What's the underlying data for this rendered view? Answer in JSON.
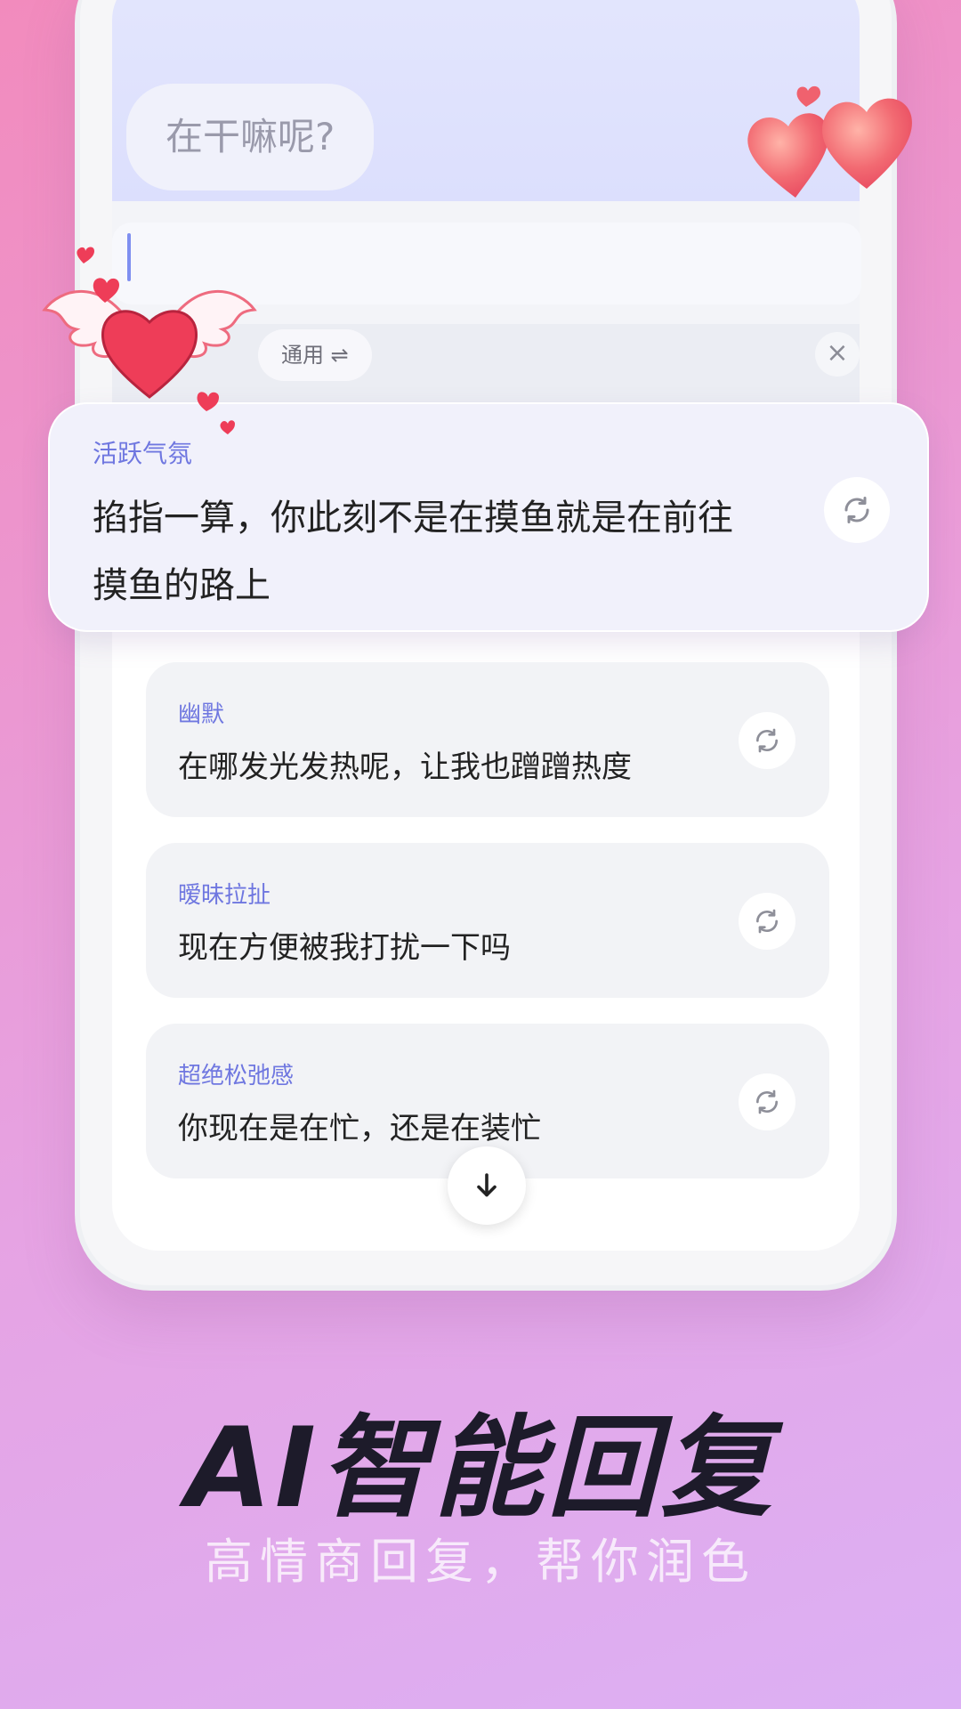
{
  "chat": {
    "incoming_message": "在干嘛呢?"
  },
  "toolbar": {
    "mode_label": "通用 ⇌",
    "close_label": "×"
  },
  "highlight_reply": {
    "category": "活跃气氛",
    "text": "掐指一算，你此刻不是在摸鱼就是在前往摸鱼的路上"
  },
  "replies": [
    {
      "category": "幽默",
      "text": "在哪发光发热呢，让我也蹭蹭热度"
    },
    {
      "category": "暧昧拉扯",
      "text": "现在方便被我打扰一下吗"
    },
    {
      "category": "超绝松弛感",
      "text": "你现在是在忙，还是在装忙"
    }
  ],
  "promo": {
    "title": "AI智能回复",
    "subtitle": "高情商回复，帮你润色"
  },
  "colors": {
    "accent": "#6f77e0",
    "background_top": "#f28bbd",
    "background_bottom": "#dcb0f4"
  }
}
